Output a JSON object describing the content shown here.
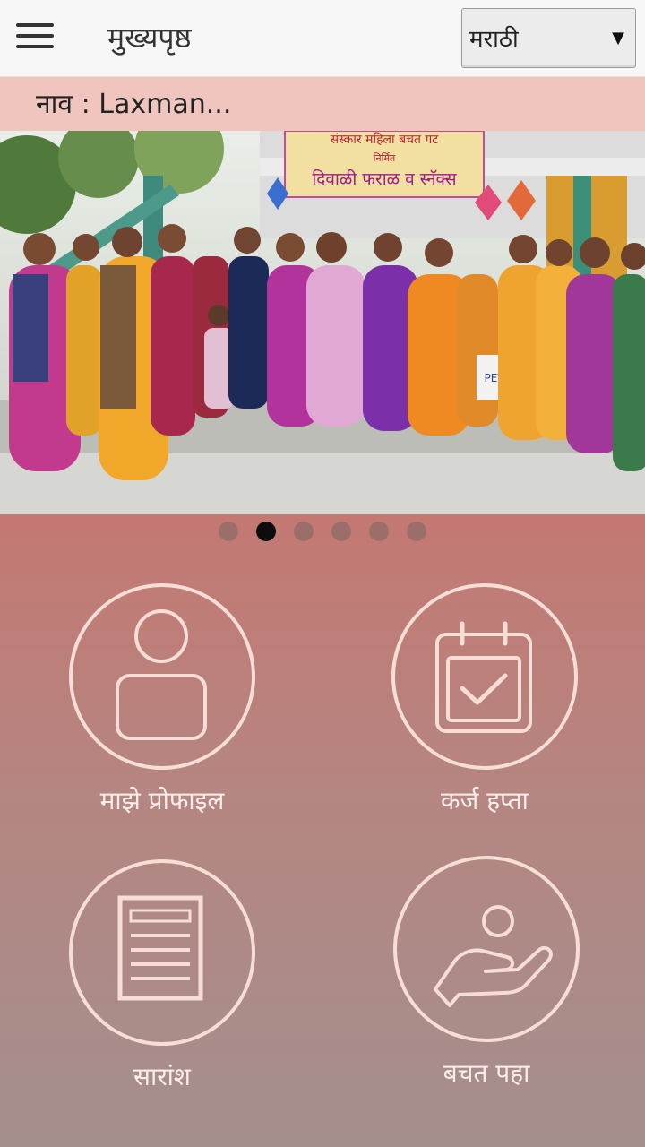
{
  "header": {
    "menu_icon": "hamburger-menu-icon",
    "title": "मुख्यपृष्ठ",
    "language": {
      "selected": "मराठी",
      "icon": "dropdown-arrow-icon"
    }
  },
  "user": {
    "name_line": "नाव : Laxman..."
  },
  "carousel": {
    "banner_text_1": "संस्कार महिला बचत गट",
    "banner_text_2": "निर्मित",
    "banner_text_3": "दिवाळी फराळ व स्नॅक्स",
    "bag_text": "PEV",
    "slide_count": 6,
    "active_slide": 2
  },
  "menu": {
    "profile": {
      "label": "माझे प्रोफाइल",
      "icon": "profile-icon"
    },
    "loan": {
      "label": "कर्ज हप्ता",
      "icon": "calendar-check-icon"
    },
    "summary": {
      "label": "सारांश",
      "icon": "document-icon"
    },
    "savings": {
      "label": "बचत पहा",
      "icon": "hand-savings-icon"
    }
  },
  "colors": {
    "name_bar": "#efc5bd",
    "tile_gradient_top": "#c47872",
    "tile_gradient_bottom": "#a48f8d",
    "icon_stroke": "#f6ddd6"
  }
}
